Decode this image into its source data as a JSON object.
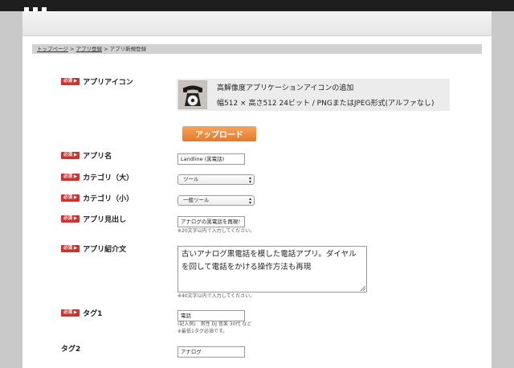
{
  "breadcrumb": {
    "items": [
      "トップページ",
      "アプリ登録"
    ],
    "separator": ">",
    "current": "アプリ新規登録"
  },
  "required_badge": "必須 ▶",
  "fields": {
    "app_icon": {
      "label": "アプリアイコン",
      "title": "高解像度アプリケーションアイコンの追加",
      "spec": "幅512 × 高さ512 24ビット / PNGまたはJPEG形式(アルファなし)",
      "upload_label": "アップロード"
    },
    "app_name": {
      "label": "アプリ名",
      "value": "Landline (黒電話)"
    },
    "category_large": {
      "label": "カテゴリ（大）",
      "selected": "ツール"
    },
    "category_small": {
      "label": "カテゴリ（小）",
      "selected": "一般ツール"
    },
    "headline": {
      "label": "アプリ見出し",
      "value": "アナログの黒電話を再現！",
      "note": "※20文字以内で入力してください。"
    },
    "description": {
      "label": "アプリ紹介文",
      "value": "古いアナログ黒電話を模した電話アプリ。ダイヤルを回して電話をかける操作方法も再現",
      "note": "※40文字以内で入力してください。"
    },
    "tag1": {
      "label": "タグ1",
      "value": "電話",
      "example": "(記入例)　男性 DJ 音楽 30代 など",
      "note": "※最低1タグ必須です。"
    },
    "tag2": {
      "label": "タグ2",
      "value": "アナログ"
    }
  },
  "colors": {
    "required": "#cc3333",
    "upload": "#e47a2c",
    "breadcrumb_bg": "#d2d2d2",
    "icon_panel_bg": "#ececec"
  },
  "icons": {
    "app_icon_preview": "black-rotary-phone-icon",
    "select_arrow": "up-down-arrows-icon"
  }
}
